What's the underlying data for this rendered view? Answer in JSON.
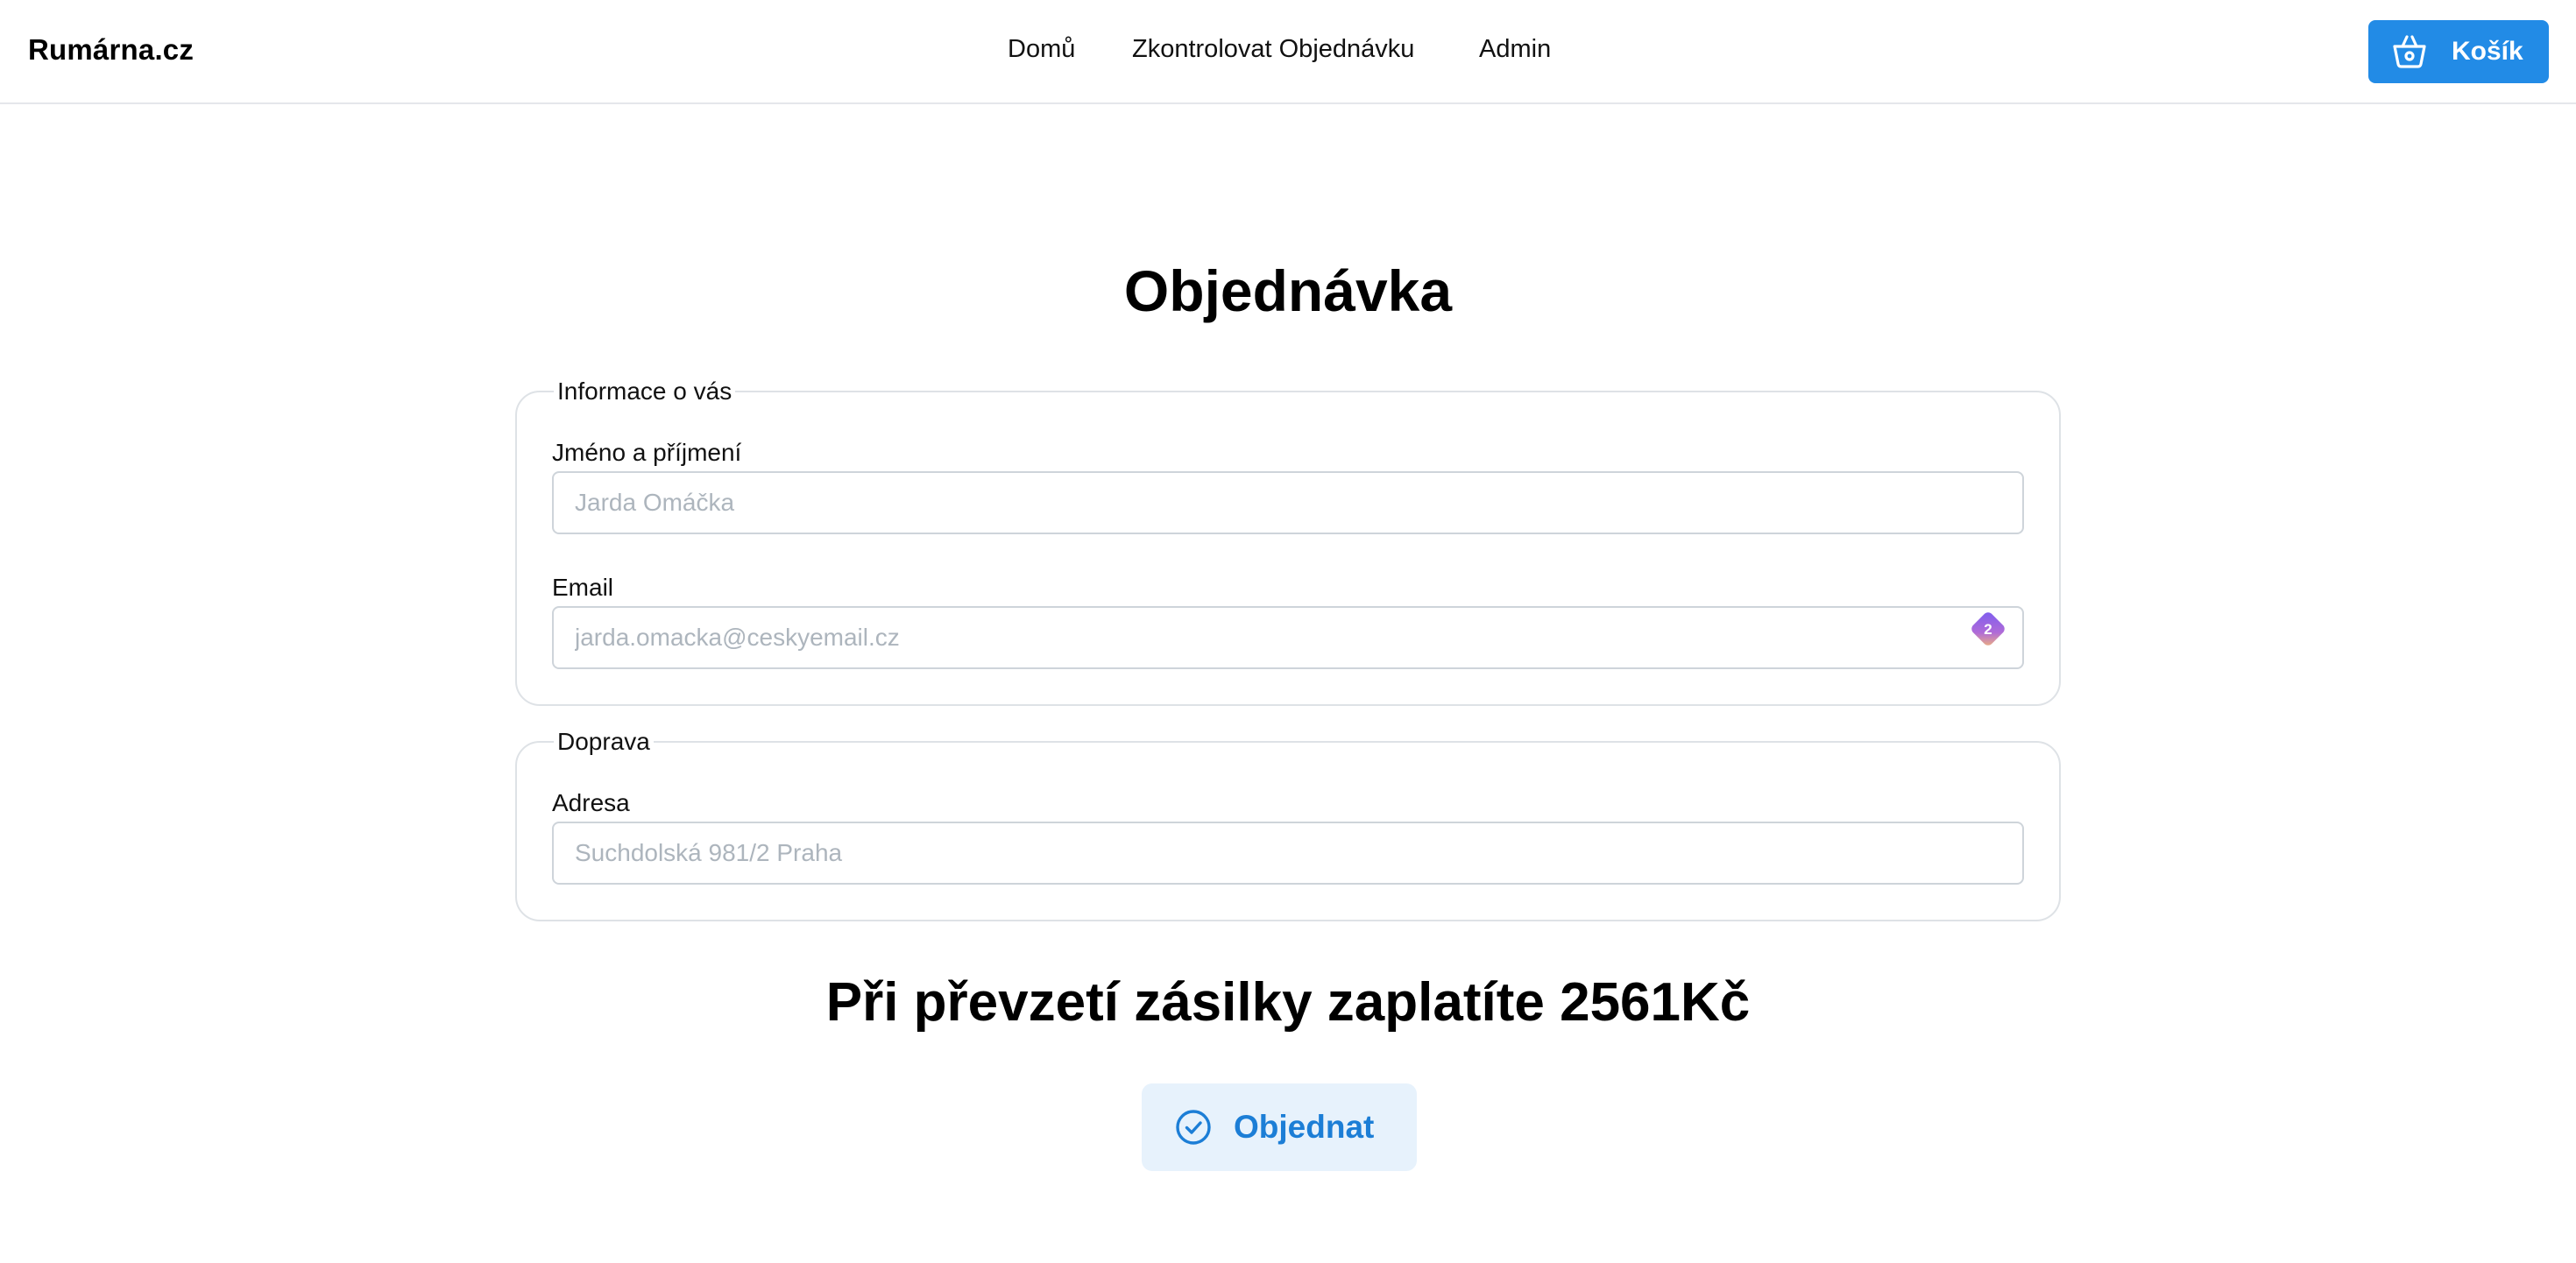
{
  "header": {
    "brand": "Rumárna.cz",
    "nav": {
      "home": "Domů",
      "check_order": "Zkontrolovat Objednávku",
      "admin": "Admin"
    },
    "cart_button": "Košík"
  },
  "main": {
    "title": "Objednávka",
    "info_section": {
      "legend": "Informace o vás",
      "name_label": "Jméno a příjmení",
      "name_placeholder": "Jarda Omáčka",
      "name_value": "",
      "email_label": "Email",
      "email_placeholder": "jarda.omacka@ceskyemail.cz",
      "email_value": "",
      "password_manager_badge": "2"
    },
    "shipping_section": {
      "legend": "Doprava",
      "address_label": "Adresa",
      "address_placeholder": "Suchdolská 981/2 Praha",
      "address_value": ""
    },
    "total_text": "Při převzetí zásilky zaplatíte 2561Kč",
    "order_button": "Objednat"
  },
  "colors": {
    "accent": "#228be6",
    "accent_light": "#e7f2fc",
    "accent_text": "#1c7ed6",
    "border": "#dee2e6"
  },
  "icons": {
    "cart": "basket-icon",
    "order": "check-circle-icon",
    "password_manager": "password-manager-icon"
  }
}
